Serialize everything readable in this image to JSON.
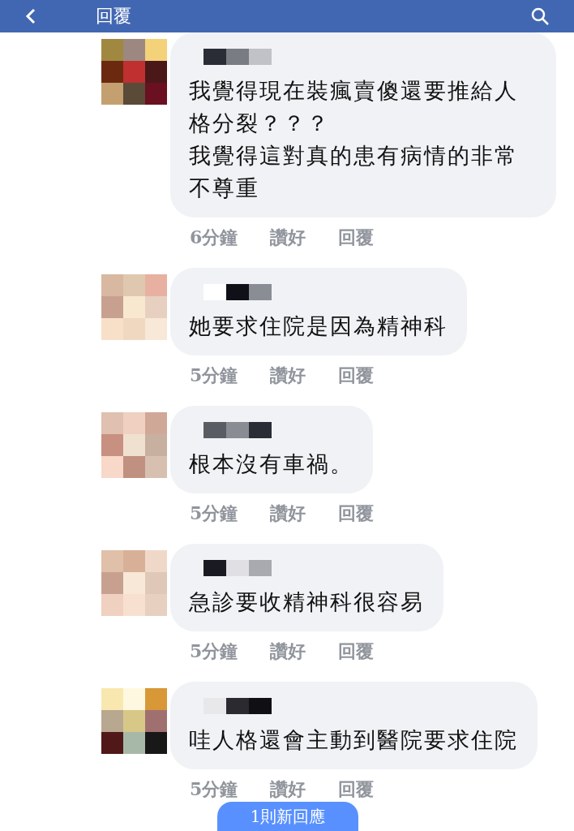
{
  "header": {
    "title": "回覆"
  },
  "comments": [
    {
      "paragraphs": [
        "我覺得現在裝瘋賣傻還要推給人格分裂？？？",
        "我覺得這對真的患有病情的非常不尊重"
      ],
      "time": "6分鐘",
      "like": "讚好",
      "reply": "回覆"
    },
    {
      "paragraphs": [
        "她要求住院是因為精神科"
      ],
      "time": "5分鐘",
      "like": "讚好",
      "reply": "回覆"
    },
    {
      "paragraphs": [
        "根本沒有車禍。"
      ],
      "time": "5分鐘",
      "like": "讚好",
      "reply": "回覆"
    },
    {
      "paragraphs": [
        "急診要收精神科很容易"
      ],
      "time": "5分鐘",
      "like": "讚好",
      "reply": "回覆"
    },
    {
      "paragraphs": [
        "哇人格還會主動到醫院要求住院"
      ],
      "time": "5分鐘",
      "like": "讚好",
      "reply": "回覆"
    }
  ],
  "new_replies_button": "1則新回應"
}
